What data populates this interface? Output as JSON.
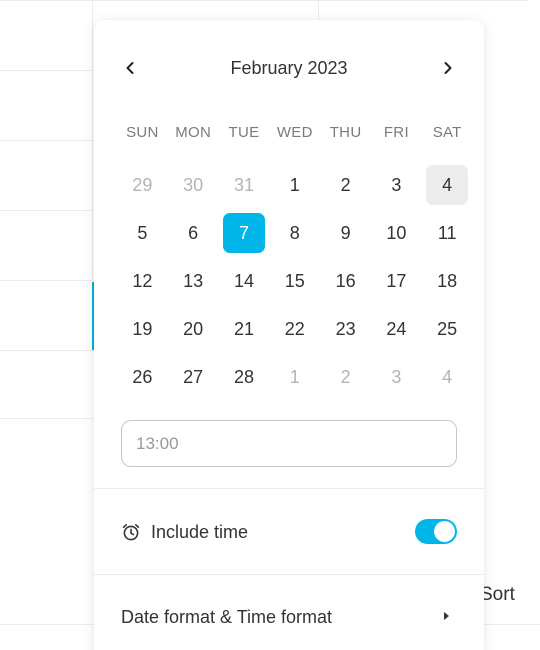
{
  "background": {
    "sort_label": "Sort",
    "accent_color": "#00b5e2"
  },
  "datepicker": {
    "month_title": "February 2023",
    "prev_icon": "chevron-left-icon",
    "next_icon": "chevron-right-icon",
    "weekdays": [
      "SUN",
      "MON",
      "TUE",
      "WED",
      "THU",
      "FRI",
      "SAT"
    ],
    "weeks": [
      [
        {
          "d": "29",
          "muted": true
        },
        {
          "d": "30",
          "muted": true
        },
        {
          "d": "31",
          "muted": true
        },
        {
          "d": "1"
        },
        {
          "d": "2"
        },
        {
          "d": "3"
        },
        {
          "d": "4",
          "hover": true
        }
      ],
      [
        {
          "d": "5"
        },
        {
          "d": "6"
        },
        {
          "d": "7",
          "selected": true
        },
        {
          "d": "8"
        },
        {
          "d": "9"
        },
        {
          "d": "10"
        },
        {
          "d": "11"
        }
      ],
      [
        {
          "d": "12"
        },
        {
          "d": "13"
        },
        {
          "d": "14"
        },
        {
          "d": "15"
        },
        {
          "d": "16"
        },
        {
          "d": "17"
        },
        {
          "d": "18"
        }
      ],
      [
        {
          "d": "19"
        },
        {
          "d": "20"
        },
        {
          "d": "21"
        },
        {
          "d": "22"
        },
        {
          "d": "23"
        },
        {
          "d": "24"
        },
        {
          "d": "25"
        }
      ],
      [
        {
          "d": "26"
        },
        {
          "d": "27"
        },
        {
          "d": "28"
        },
        {
          "d": "1",
          "muted": true
        },
        {
          "d": "2",
          "muted": true
        },
        {
          "d": "3",
          "muted": true
        },
        {
          "d": "4",
          "muted": true
        }
      ]
    ],
    "selected_color": "#00b5e8",
    "time_input": {
      "value": "",
      "placeholder": "13:00"
    },
    "include_time": {
      "icon": "alarm-clock-icon",
      "label": "Include time",
      "enabled": true
    },
    "format_menu": {
      "label": "Date format & Time format",
      "icon": "caret-right-icon"
    }
  }
}
